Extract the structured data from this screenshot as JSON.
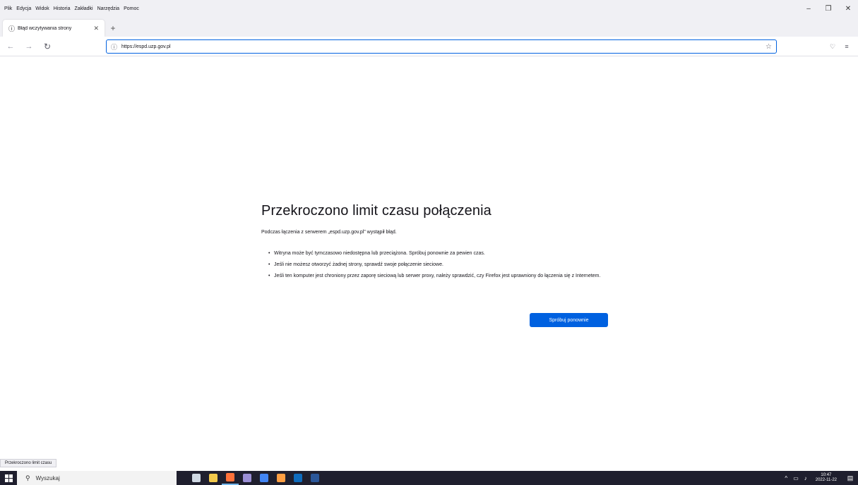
{
  "menubar": {
    "items": [
      "Plik",
      "Edycja",
      "Widok",
      "Historia",
      "Zakładki",
      "Narzędzia",
      "Pomoc"
    ]
  },
  "window_controls": {
    "minimize": "–",
    "maximize": "❐",
    "close": "✕"
  },
  "tabs": [
    {
      "title": "Błąd wczytywania strony",
      "icon": "info-icon"
    }
  ],
  "navbar": {
    "url": "https://espd.uzp.gov.pl",
    "icons": {
      "back": "←",
      "forward": "→",
      "reload": "↻",
      "star": "☆",
      "pocket": "♡",
      "menu": "≡"
    }
  },
  "error": {
    "title": "Przekroczono limit czasu połączenia",
    "description": "Podczas łączenia z serwerem „espd.uzp.gov.pl” wystąpił błąd.",
    "bullets": [
      "Witryna może być tymczasowo niedostępna lub przeciążona. Spróbuj ponownie za pewien czas.",
      "Jeśli nie możesz otworzyć żadnej strony, sprawdź swoje połączenie sieciowe.",
      "Jeśli ten komputer jest chroniony przez zaporę sieciową lub serwer proxy, należy sprawdzić, czy Firefox jest uprawniony do łączenia się z Internetem."
    ],
    "retry_label": "Spróbuj ponownie"
  },
  "statusbar": {
    "text": "Przekroczono limit czasu"
  },
  "taskbar": {
    "search_placeholder": "Wyszukaj",
    "apps": [
      {
        "name": "task-view",
        "color": "#cfd8e3"
      },
      {
        "name": "file-explorer",
        "color": "#f2c94c"
      },
      {
        "name": "firefox",
        "color": "#ff7139"
      },
      {
        "name": "paint",
        "color": "#9b8fd6"
      },
      {
        "name": "chrome",
        "color": "#4285f4"
      },
      {
        "name": "firefox-dev",
        "color": "#ff9f43"
      },
      {
        "name": "outlook",
        "color": "#0f6cbd"
      },
      {
        "name": "word",
        "color": "#2b579a"
      }
    ],
    "time": "10:47",
    "date": "2022-11-22"
  },
  "colors": {
    "accent": "#0061e0",
    "taskbar": "#1f1f2e"
  }
}
